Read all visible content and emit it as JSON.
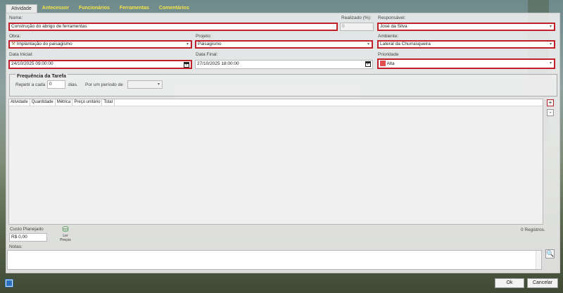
{
  "tabs": [
    "Atividade",
    "Antecessor",
    "Funcionários",
    "Ferramentas",
    "Comentários"
  ],
  "form": {
    "nome_label": "Nome:",
    "nome_value": "Construção do abrigo de ferramentas",
    "realizado_label": "Realizado (%):",
    "realizado_value": "0",
    "responsavel_label": "Responsável:",
    "responsavel_value": "José da Silva",
    "obra_label": "Obra:",
    "obra_value": "Implantação do paisagismo",
    "projeto_label": "Projeto:",
    "projeto_value": "Paisagismo",
    "ambiente_label": "Ambiente:",
    "ambiente_value": "Lateral da Churrasqueira",
    "data_inicial_label": "Data Inicial:",
    "data_inicial_value": "24/10/2025 09:00:00",
    "data_final_label": "Data Final:",
    "data_final_value": "27/10/2025 18:00:00",
    "prioridade_label": "Prioridade",
    "prioridade_value": "Alta",
    "calendar_glyph": "7"
  },
  "frequency": {
    "title": "Frequência da Tarefa",
    "repeat_label": "Repetir a cada",
    "repeat_value": "0",
    "days_label": "dias.",
    "period_label": "Por um período de",
    "period_value": ""
  },
  "grid": {
    "columns": [
      "Atividade",
      "Quantidade",
      "Métrica",
      "Preço unitário",
      "Total"
    ]
  },
  "side_buttons": {
    "add": "+",
    "remove": "-"
  },
  "footer": {
    "custo_label": "Custo Planejado",
    "custo_value": "R$ 0,00",
    "ler_precos": "Ler Preços",
    "registros": "0 Registros.",
    "notas_label": "Notas:"
  },
  "buttons": {
    "ok": "Ok",
    "cancelar": "Cancelar"
  },
  "colors": {
    "required_border": "#c0202a",
    "tab_text": "#f4e34a",
    "priority_alta": "#e05050"
  }
}
